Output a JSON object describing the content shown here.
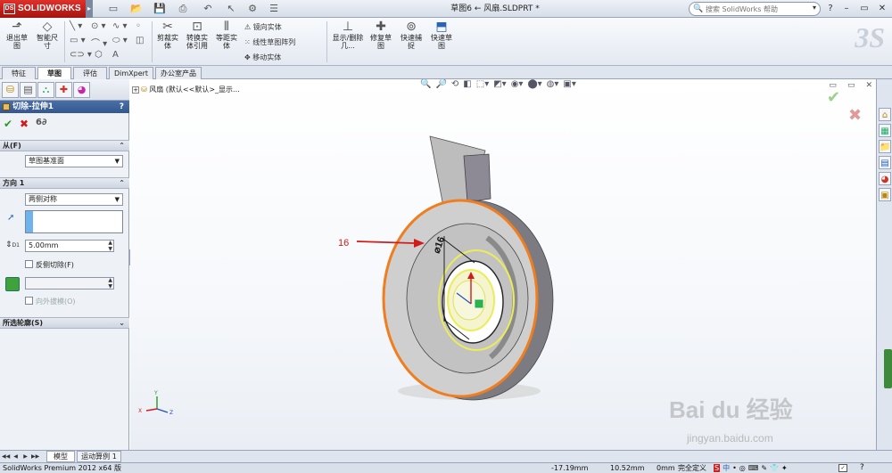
{
  "app": {
    "brand": "SOLIDWORKS",
    "doc_title": "草图6 ← 风扇.SLDPRT *",
    "search_placeholder": "搜索 SolidWorks 帮助"
  },
  "commands": {
    "exit_sketch": "退出草图",
    "smart_dim": "智能尺寸",
    "trim": "剪裁实体",
    "convert": "转换实体引用",
    "offset": "等距实体",
    "mirror": "镜向实体",
    "linear_pattern": "线性草图阵列",
    "move": "移动实体",
    "display_delete": "显示/删除几...",
    "repair": "修复草图",
    "quick_snaps": "快速捕捉",
    "rapid_sketch": "快速草图"
  },
  "tabs": [
    "特征",
    "草图",
    "评估",
    "DimXpert",
    "办公室产品"
  ],
  "active_tab": 1,
  "property_manager": {
    "title": "切除-拉伸1",
    "help": "?",
    "section_from": "从(F)",
    "from_value": "草图基准面",
    "section_direction": "方向 1",
    "direction_value": "两侧对称",
    "depth_value": "5.00mm",
    "depth_label": "D1",
    "flip_side": "反侧切除(F)",
    "draft_outward": "向外拔模(O)",
    "section_contours": "所选轮廓(S)"
  },
  "viewport": {
    "tree_item": "风扇  (默认<<默认>_显示...",
    "callout": "16",
    "sketch_dim": "⌀16"
  },
  "bottom_tabs": [
    "模型",
    "运动算例 1"
  ],
  "status": {
    "product": "SolidWorks Premium 2012 x64 版",
    "x": "-17.19mm",
    "y": "10.52mm",
    "z": "0mm",
    "state": "完全定义"
  },
  "ime": [
    "S",
    "中",
    "•",
    "◎",
    "⌨",
    "✎",
    "👕",
    "✦"
  ],
  "watermark": {
    "text": "Bai du 经验",
    "url": "jingyan.baidu.com"
  },
  "colors": {
    "accent_red": "#d21c1c",
    "edge_orange": "#f07d1e",
    "sketch_yellow": "#ecec58",
    "title_blue": "#3a5e96"
  }
}
